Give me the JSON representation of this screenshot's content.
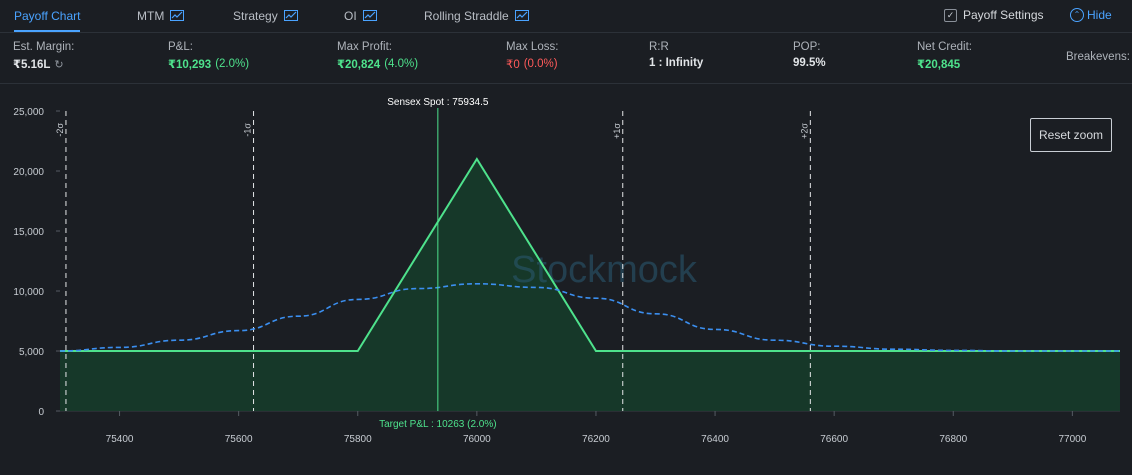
{
  "tabs": [
    {
      "label": "Payoff Chart",
      "active": true,
      "icon": ""
    },
    {
      "label": "MTM",
      "icon": "line-chart-icon"
    },
    {
      "label": "Strategy",
      "icon": "line-chart-icon"
    },
    {
      "label": "OI",
      "icon": "line-chart-icon"
    },
    {
      "label": "Rolling Straddle",
      "icon": "line-chart-icon"
    }
  ],
  "settings": {
    "label": "Payoff Settings",
    "checked": true
  },
  "hide": {
    "label": "Hide"
  },
  "stats": {
    "margin": {
      "label": "Est. Margin:",
      "value": "₹5.16L"
    },
    "pnl": {
      "label": "P&L:",
      "value": "₹10,293",
      "sub": "(2.0%)"
    },
    "max_profit": {
      "label": "Max Profit:",
      "value": "₹20,824",
      "sub": "(4.0%)"
    },
    "max_loss": {
      "label": "Max Loss:",
      "value": "₹0",
      "sub": "(0.0%)"
    },
    "rr": {
      "label": "R:R",
      "value": "1 : Infinity"
    },
    "pop": {
      "label": "POP:",
      "value": "99.5%"
    },
    "net_credit": {
      "label": "Net Credit:",
      "value": "₹20,845"
    },
    "breakevens": {
      "label": "Breakevens:"
    }
  },
  "reset_zoom": "Reset zoom",
  "colors": {
    "payoff_line": "#4ee28c",
    "payoff_fill": "#163b2a",
    "distribution": "#3b8ff0",
    "spot_line": "#4ee28c"
  },
  "chart_data": {
    "type": "area",
    "xlim": [
      75300,
      77080
    ],
    "ylim": [
      0,
      25000
    ],
    "x_ticks": [
      75400,
      75600,
      75800,
      76000,
      76200,
      76400,
      76600,
      76800,
      77000
    ],
    "y_ticks": [
      0,
      5000,
      10000,
      15000,
      20000,
      25000
    ],
    "y_tick_labels": [
      "0",
      "5,000",
      "10,000",
      "15,000",
      "20,000",
      "25,000"
    ],
    "series": [
      {
        "kind": "payoff",
        "x": [
          75300,
          75800,
          76000,
          76200,
          77080
        ],
        "y": [
          5000,
          5000,
          21000,
          5000,
          5000
        ]
      },
      {
        "kind": "distribution",
        "style": "dashed",
        "x": [
          75300,
          75400,
          75500,
          75600,
          75700,
          75800,
          75900,
          76000,
          76100,
          76200,
          76300,
          76400,
          76500,
          76600,
          76700,
          76800,
          76900,
          77000,
          77080
        ],
        "y": [
          5000,
          5300,
          5900,
          6700,
          7900,
          9300,
          10200,
          10600,
          10300,
          9400,
          8100,
          6800,
          5900,
          5400,
          5150,
          5050,
          5000,
          5000,
          5000
        ]
      }
    ],
    "sd_lines": [
      {
        "label": "-2σ",
        "x": 75310
      },
      {
        "label": "-1σ",
        "x": 75625
      },
      {
        "label": "+1σ",
        "x": 76245
      },
      {
        "label": "+2σ",
        "x": 76560
      }
    ],
    "spot": {
      "label": "Sensex Spot : 75934.5",
      "x": 75934.5
    },
    "target_label": "Target P&L : 10263 (2.0%)",
    "watermark": "Stockmock"
  }
}
